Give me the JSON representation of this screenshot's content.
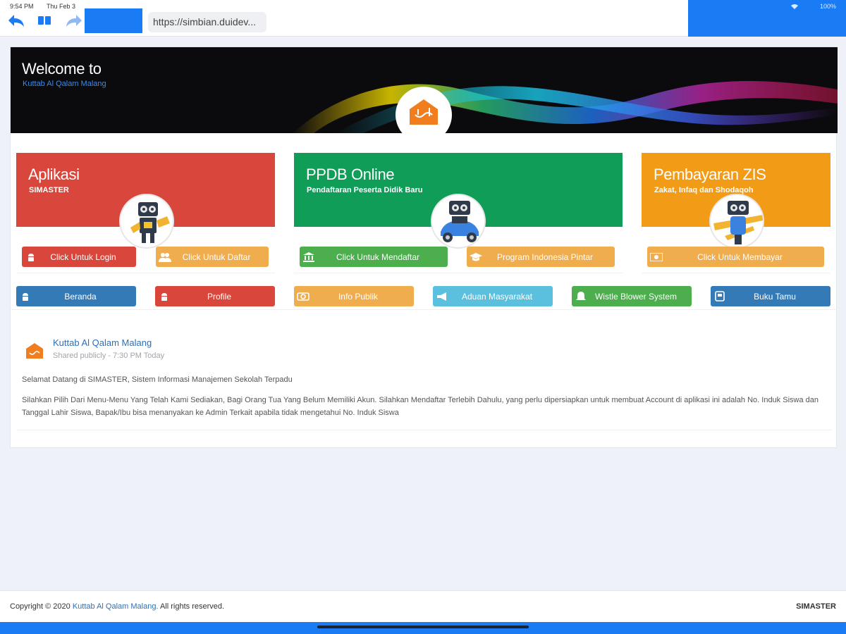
{
  "status": {
    "time": "9:54 PM",
    "date": "Thu Feb 3",
    "battery": "100%"
  },
  "browser": {
    "url": "https://simbian.duidev...",
    "icons": [
      "back-arrow-icon",
      "reader-icon",
      "forward-arrow-icon"
    ]
  },
  "banner": {
    "title": "Welcome to",
    "subtitle": "Kuttab Al Qalam Malang",
    "logo_text": "القلم"
  },
  "services": [
    {
      "title": "Aplikasi",
      "subtitle": "SIMASTER",
      "color": "#d9473c",
      "buttons": [
        {
          "label": "Click Untuk Login",
          "icon": "android-icon"
        },
        {
          "label": "Click Untuk Daftar",
          "icon": "users-icon"
        }
      ]
    },
    {
      "title": "PPDB Online",
      "subtitle": "Pendaftaran Peserta Didik Baru",
      "color": "#0f9d58",
      "buttons": [
        {
          "label": "Click Untuk Mendaftar",
          "icon": "bank-icon"
        },
        {
          "label": "Program Indonesia Pintar",
          "icon": "graduation-cap-icon"
        }
      ]
    },
    {
      "title": "Pembayaran ZIS",
      "subtitle": "Zakat, Infaq dan Shodaqoh",
      "color": "#f29b16",
      "buttons": [
        {
          "label": "Click Untuk Membayar",
          "icon": "money-icon"
        }
      ]
    }
  ],
  "bottom_buttons": [
    {
      "label": "Beranda",
      "icon": "android-icon"
    },
    {
      "label": "Profile",
      "icon": "android-icon"
    },
    {
      "label": "Info Publik",
      "icon": "camera-icon"
    },
    {
      "label": "Aduan Masyarakat",
      "icon": "megaphone-icon"
    },
    {
      "label": "Wistle Blower System",
      "icon": "bell-icon"
    },
    {
      "label": "Buku Tamu",
      "icon": "book-icon"
    }
  ],
  "post": {
    "author": "Kuttab Al Qalam Malang",
    "meta": "Shared publicly - 7:30 PM Today",
    "line1": "Selamat Datang di SIMASTER, Sistem Informasi Manajemen Sekolah Terpadu",
    "line2": "Silahkan Pilih Dari Menu-Menu Yang Telah Kami Sediakan, Bagi Orang Tua Yang Belum Memiliki Akun. Silahkan Mendaftar Terlebih Dahulu, yang perlu dipersiapkan untuk membuat Account di aplikasi ini adalah No. Induk Siswa dan Tanggal Lahir Siswa, Bapak/Ibu bisa menanyakan ke Admin Terkait apabila tidak mengetahui No. Induk Siswa"
  },
  "footer": {
    "copyright_prefix": "Copyright © 2020",
    "copyright_link": "Kuttab Al Qalam Malang.",
    "copyright_suffix": "All rights reserved.",
    "brand": "SIMASTER"
  },
  "colors": {
    "accent_blue": "#1a7cf4",
    "red": "#d9473c",
    "green": "#0f9d58",
    "orange": "#f29b16",
    "link": "#2f6fb5"
  }
}
